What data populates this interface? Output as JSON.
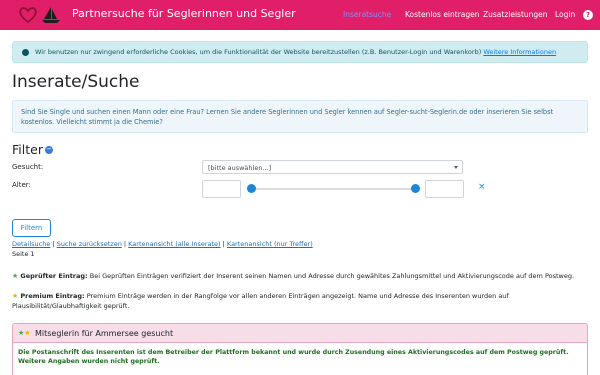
{
  "nav": {
    "brand": "Partnersuche für Seglerinnen und Segler",
    "items": [
      {
        "label": "Inseratsuche",
        "active": true
      },
      {
        "label": "Kostenlos eintragen",
        "active": false
      },
      {
        "label": "Zusatzleistungen",
        "active": false
      },
      {
        "label": "Login",
        "active": false
      }
    ],
    "help_icon": "?"
  },
  "cookie": {
    "text": "Wir benutzen nur zwingend erforderliche Cookies, um die Funktionalität der Website bereitzustellen (z.B. Benutzer-Login und Warenkorb)",
    "link": "Weitere Informationen"
  },
  "page": {
    "title": "Inserate/Suche",
    "intro": "Sind Sie Single und suchen einen Mann oder eine Frau? Lernen Sie andere Seglerinnen und Segler kennen auf Segler-sucht-Seglerin.de oder inserieren Sie selbst kostenlos. Vielleicht stimmt ja die Chemie?"
  },
  "filter": {
    "heading": "Filter",
    "toggle": "−",
    "gesucht_label": "Gesucht:",
    "gesucht_value": "[bitte auswählen...]",
    "alter_label": "Alter:",
    "alter_min": "",
    "alter_max": "",
    "clear": "×",
    "submit": "Filtern"
  },
  "links": {
    "items": [
      "Detailsuche",
      "Suche zurücksetzen",
      "Kartenansicht (alle Inserate)",
      "Kartenansicht (nur Treffer)"
    ],
    "separator": " | "
  },
  "paging": {
    "label": "Seite 1"
  },
  "legend": {
    "verified_title": "Geprüfter Eintrag:",
    "verified_text": "Bei Geprüften Einträgen verifiziert der Inserent seinen Namen und Adresse durch gewähites Zahlungsmittel und Aktivierungscode auf dem Postweg.",
    "premium_title": "Premium Eintrag:",
    "premium_text": "Premium Einträge werden in der Rangfolge vor allen anderen Einträgen angezeigt. Name und Adresse des Inserenten wurden auf Plausibilität/Glaubhaftigkeit geprüft."
  },
  "listing": {
    "title": "Mitseglerin für Ammersee gesucht",
    "body": "Die Postanschrift des Inserenten ist dem Betreiber der Plattform bekannt und wurde durch Zusendung eines Aktivierungscodes auf dem Postweg geprüft. Weitere Angaben wurden nicht geprüft."
  },
  "colors": {
    "brand": "#e01f68",
    "accent": "#1a88d6",
    "info_bg": "#d1ecf1",
    "listing_head": "#f7dde8"
  },
  "icons": {
    "verified": "star",
    "premium": "star",
    "logo": "heart-sailboat"
  }
}
